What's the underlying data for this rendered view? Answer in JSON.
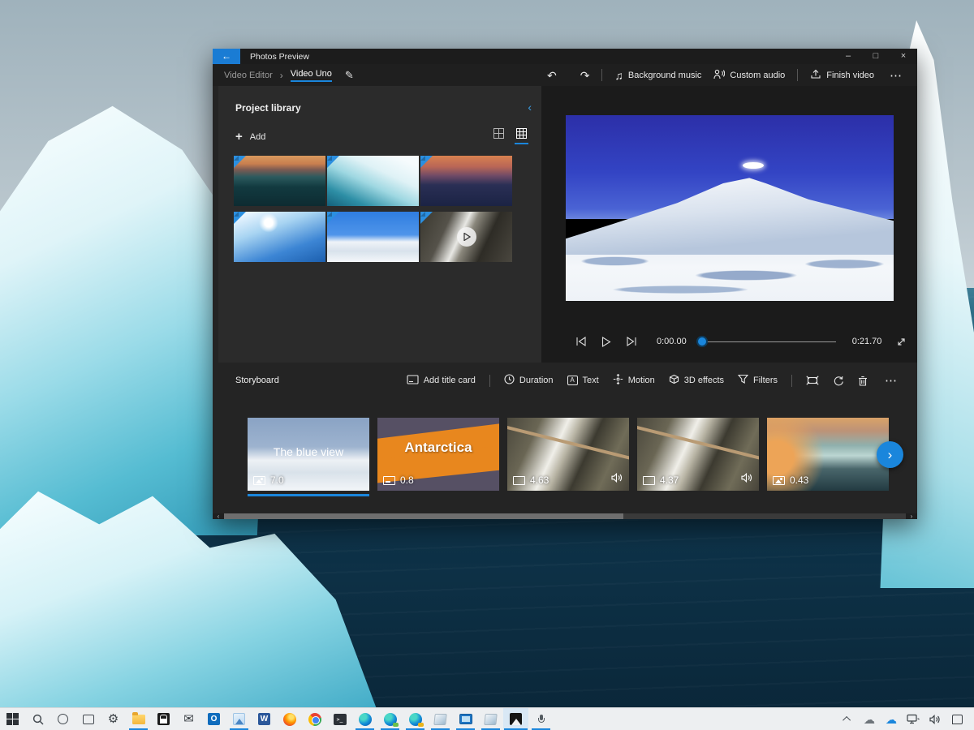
{
  "colors": {
    "accent": "#1a86dc",
    "window_bg": "#1f1f1f",
    "library_bg": "#2b2b2b",
    "storyboard_bg": "#242424",
    "taskbar_bg": "#edeff1"
  },
  "icons": {
    "back": "←",
    "minimize": "–",
    "maximize": "□",
    "close": "×",
    "breadcrumb_separator": "›",
    "edit_pencil": "✎",
    "undo": "↶",
    "redo": "↷",
    "music_note": "♫",
    "more": "⋯",
    "collapse_chevron": "‹",
    "add_plus": "+",
    "next_chevron": "›",
    "scroll_left": "‹",
    "scroll_right": "›",
    "text_tool_letter": "A",
    "word_logo": "W",
    "outlook_logo": "O",
    "terminal_prompt": ">_",
    "mail_envelope": "✉",
    "settings_gear": "⚙",
    "cloud": "☁"
  },
  "window": {
    "title": "Photos Preview",
    "breadcrumb": {
      "parent": "Video Editor",
      "current": "Video Uno"
    },
    "toolbar": {
      "background_music": "Background music",
      "custom_audio": "Custom audio",
      "finish_video": "Finish video"
    },
    "project_library": {
      "title": "Project library",
      "add_label": "Add",
      "thumbnails": [
        {
          "name": "iceberg-sunset-dark",
          "selected": true
        },
        {
          "name": "ice-closeup",
          "selected": true
        },
        {
          "name": "iceberg-sunset-purple",
          "selected": true
        },
        {
          "name": "blue-ice-slope",
          "selected": true
        },
        {
          "name": "snow-mountain",
          "selected": true
        },
        {
          "name": "rocks-waterfall-video",
          "selected": true,
          "is_video": true
        }
      ]
    },
    "preview": {
      "current_time": "0:00.00",
      "total_time": "0:21.70"
    },
    "storyboard": {
      "title": "Storyboard",
      "add_title_card": "Add title card",
      "tools": {
        "duration": "Duration",
        "text": "Text",
        "motion": "Motion",
        "effects": "3D effects",
        "filters": "Filters"
      },
      "clips": [
        {
          "title": "The blue view",
          "duration": "7.0",
          "type": "photo",
          "selected": true
        },
        {
          "title": "Antarctica",
          "duration": "0.8",
          "type": "title-card"
        },
        {
          "duration": "4.63",
          "type": "video",
          "audio": true
        },
        {
          "duration": "4.37",
          "type": "video",
          "audio": true
        },
        {
          "duration": "0.43",
          "type": "photo"
        }
      ]
    }
  },
  "taskbar": {
    "apps": [
      "start",
      "search",
      "cortana",
      "task-view",
      "settings",
      "file-explorer",
      "store",
      "mail",
      "outlook",
      "photos-light",
      "word",
      "firefox",
      "chrome",
      "terminal",
      "edge",
      "edge-beta",
      "edge-canary",
      "app-glassy-1",
      "this-pc",
      "app-glassy-2",
      "photos",
      "feedback-hub"
    ],
    "running": [
      "file-explorer",
      "photos-light",
      "edge",
      "edge-beta",
      "edge-canary",
      "app-glassy-1",
      "this-pc",
      "app-glassy-2",
      "photos",
      "feedback-hub"
    ],
    "active": "photos",
    "tray": [
      "show-hidden",
      "onedrive-gray",
      "onedrive-blue",
      "network",
      "volume",
      "action-center"
    ]
  }
}
